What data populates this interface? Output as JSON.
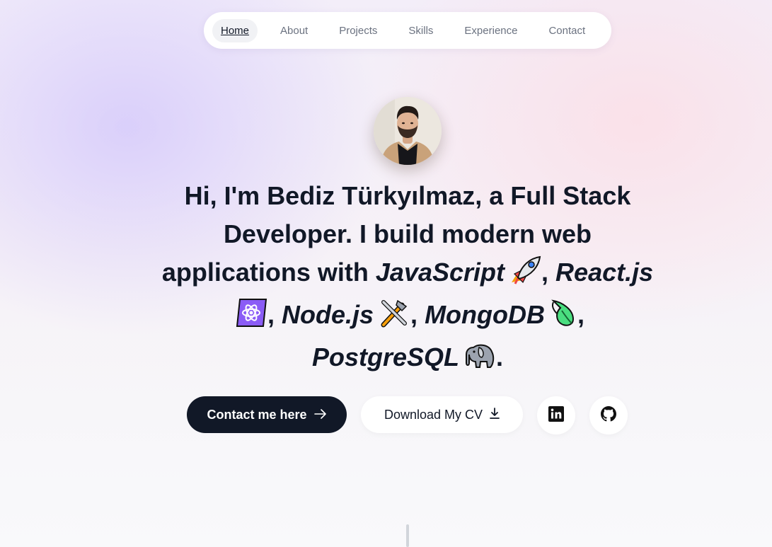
{
  "nav": {
    "items": [
      {
        "label": "Home"
      },
      {
        "label": "About"
      },
      {
        "label": "Projects"
      },
      {
        "label": "Skills"
      },
      {
        "label": "Experience"
      },
      {
        "label": "Contact"
      }
    ],
    "active": "Home"
  },
  "hero": {
    "greeting": "Hi, I'm ",
    "name": "Bediz Türkyılmaz",
    "sep": ", a ",
    "role": "Full Stack Developer.",
    "intro": " I build modern web applications with ",
    "tech": {
      "javascript": "JavaScript",
      "react": "React.js",
      "node": "Node.js",
      "mongodb": "MongoDB",
      "postgres": "PostgreSQL"
    },
    "comma": ",",
    "period": "."
  },
  "actions": {
    "contact_label": "Contact me here",
    "download_label": "Download My CV",
    "linkedin_icon": "linkedin-icon",
    "github_icon": "github-icon"
  },
  "colors": {
    "primary_button": "#111827",
    "text": "#111827",
    "nav_muted": "#6b7280"
  }
}
